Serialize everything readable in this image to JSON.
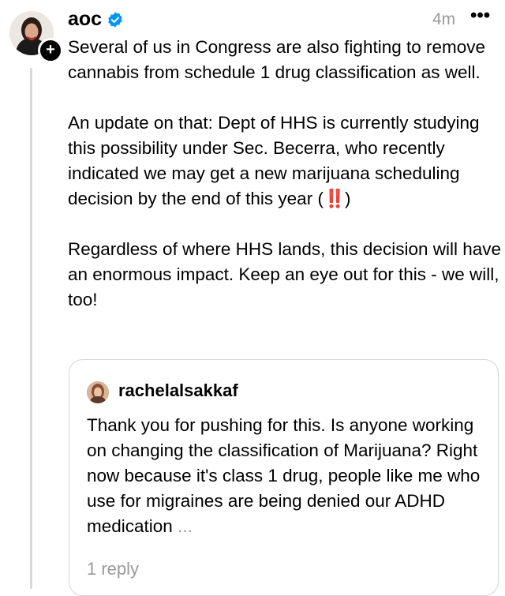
{
  "post": {
    "username": "aoc",
    "timestamp": "4m",
    "more_label": "•••",
    "paragraphs": [
      "Several of us in Congress are also fighting to remove cannabis from schedule 1 drug classification as well.",
      "An update on that: Dept of HHS is currently studying this possibility under Sec. Becerra, who recently indicated we may get a new marijuana scheduling decision by the end of this year (",
      "Regardless of where HHS lands, this decision will have an enormous impact. Keep an eye out for this - we will, too!"
    ],
    "emoji": "‼️",
    "paren_close": ")"
  },
  "quoted_post": {
    "username": "rachelalsakkaf",
    "text": "Thank you for pushing for this. Is anyone working on changing the classification of Marijuana? Right now because it's class 1 drug, people like me who use for migraines are being denied our ADHD medication",
    "ellipsis": "...",
    "reply_count": "1 reply"
  },
  "colors": {
    "verified_blue": "#0095f6",
    "emoji_red": "#e0241c",
    "muted_text": "#999999"
  },
  "icons": [
    "avatar",
    "follow-plus-icon",
    "verified-badge-icon",
    "more-options-icon",
    "quoted-avatar"
  ]
}
